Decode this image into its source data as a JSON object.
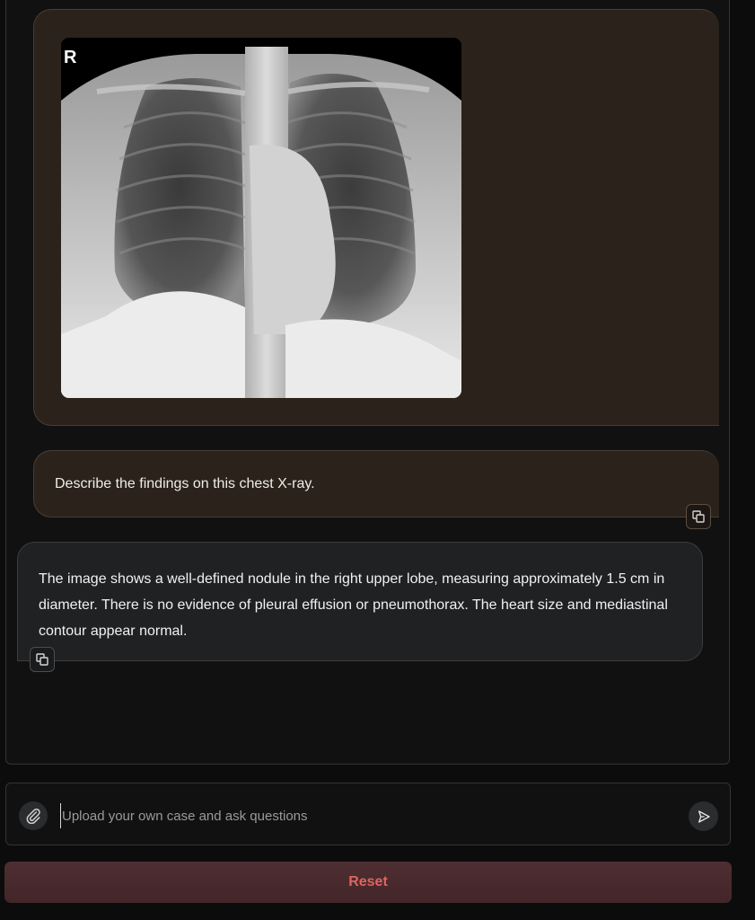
{
  "chat": {
    "user_image": {
      "alt": "chest X-ray",
      "marker": "R"
    },
    "user_message": "Describe the findings on this chest X-ray.",
    "bot_message": "The image shows a well-defined nodule in the right upper lobe, measuring approximately 1.5 cm in diameter. There is no evidence of pleural effusion or pneumothorax. The heart size and mediastinal contour appear normal."
  },
  "composer": {
    "placeholder": "Upload your own case and ask questions",
    "value": ""
  },
  "actions": {
    "reset_label": "Reset"
  },
  "colors": {
    "user_bubble": "#2a221b",
    "bot_bubble": "#1f2123",
    "reset_text": "#e0645c",
    "reset_bg": "#4e2e32"
  }
}
